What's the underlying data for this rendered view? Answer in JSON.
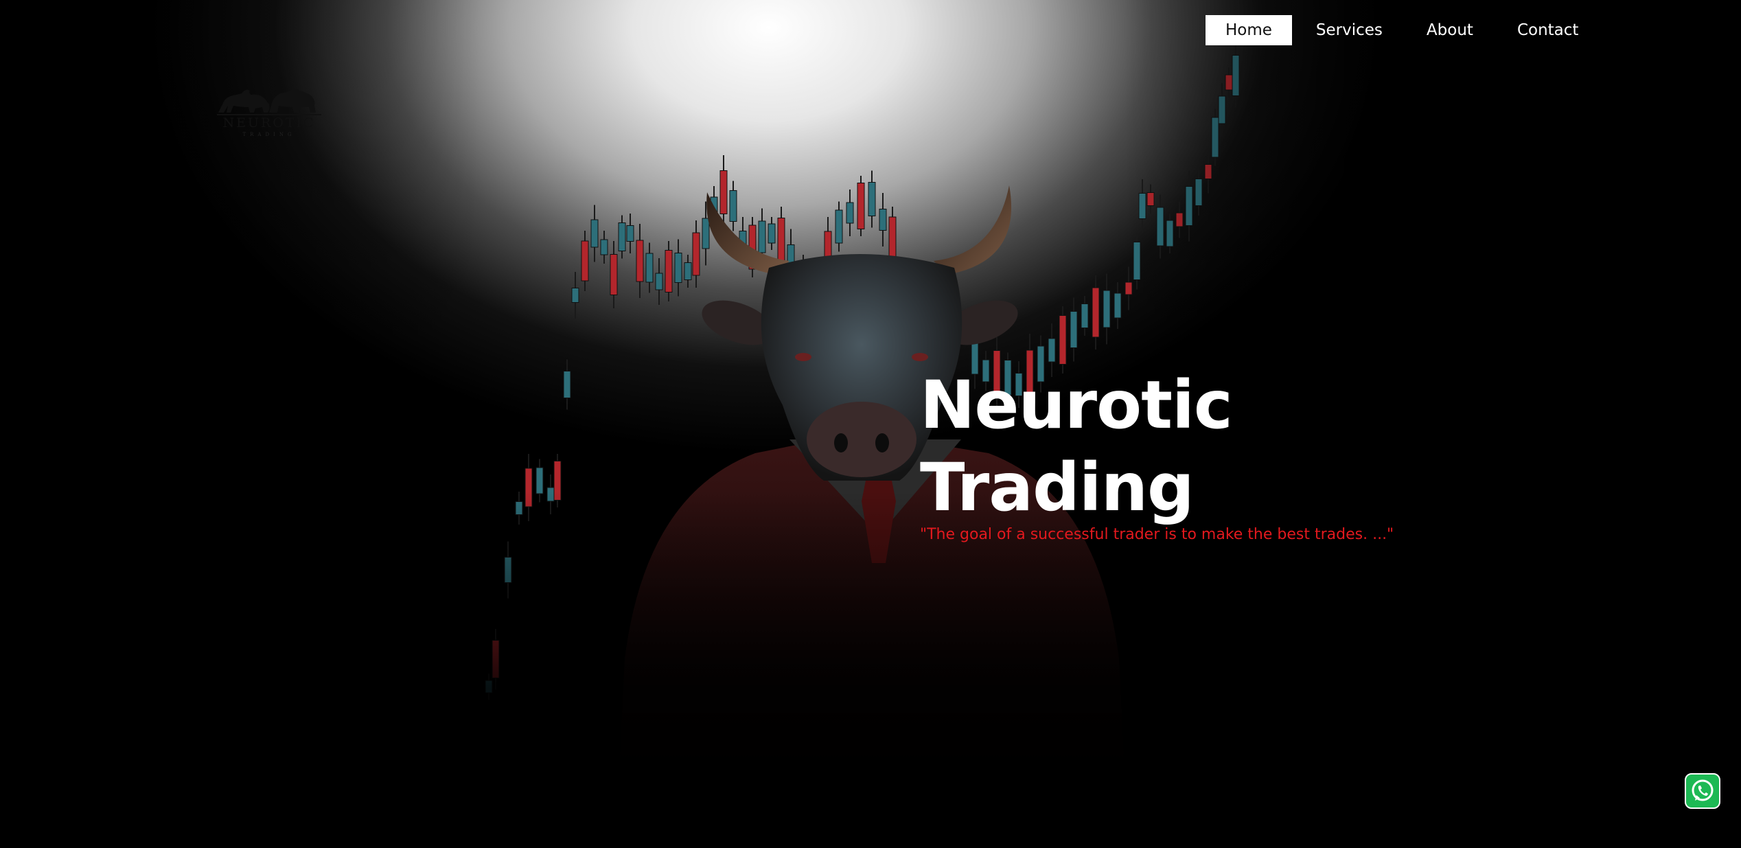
{
  "nav": {
    "items": [
      {
        "label": "Home",
        "active": true
      },
      {
        "label": "Services",
        "active": false
      },
      {
        "label": "About",
        "active": false
      },
      {
        "label": "Contact",
        "active": false
      }
    ]
  },
  "logo": {
    "name": "NEUROTIC",
    "sub": "TRADING",
    "icon": "bull-and-bear-icon"
  },
  "hero": {
    "title_line1": "Neurotic",
    "title_line2": "Trading",
    "quote": "\"The goal of a successful trader is to make the best trades. ...\""
  },
  "floating": {
    "whatsapp_icon": "whatsapp-icon"
  },
  "colors": {
    "accent_red": "#e3191e",
    "candle_up": "#2d6f7a",
    "candle_down": "#b3262c"
  }
}
